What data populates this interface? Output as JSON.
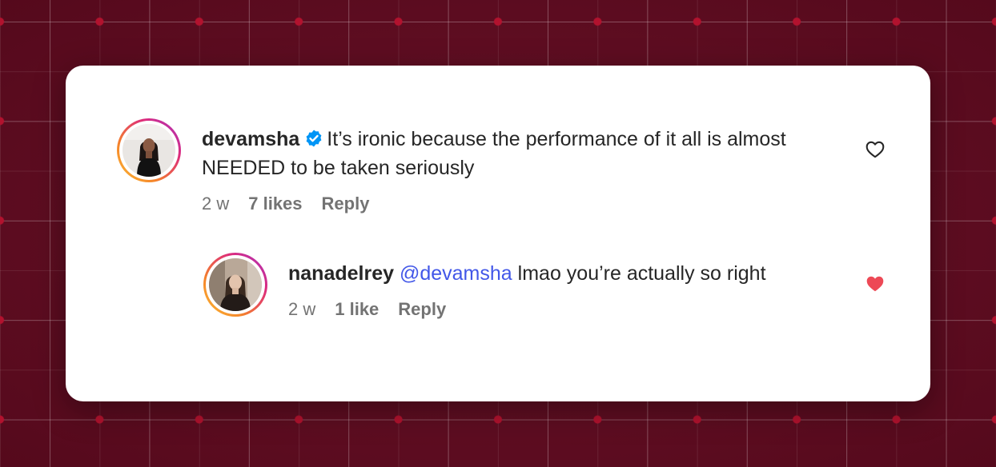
{
  "comments": [
    {
      "username": "devamsha",
      "verified": true,
      "mention": "",
      "text": "It’s ironic because the performance of it all is almost NEEDED to be taken seriously",
      "time": "2 w",
      "likes": "7 likes",
      "reply_label": "Reply",
      "liked": false
    },
    {
      "username": "nanadelrey",
      "verified": false,
      "mention": "@devamsha",
      "text": "lmao you’re actually so right",
      "time": "2 w",
      "likes": "1 like",
      "reply_label": "Reply",
      "liked": true
    }
  ],
  "colors": {
    "background": "#5c0f22",
    "mention": "#4257e8",
    "heart_liked": "#ed4956",
    "verified": "#0095f6",
    "meta_text": "#737373"
  },
  "icons": {
    "verified": "verified-badge-icon",
    "like_empty": "heart-outline-icon",
    "like_filled": "heart-filled-icon"
  }
}
